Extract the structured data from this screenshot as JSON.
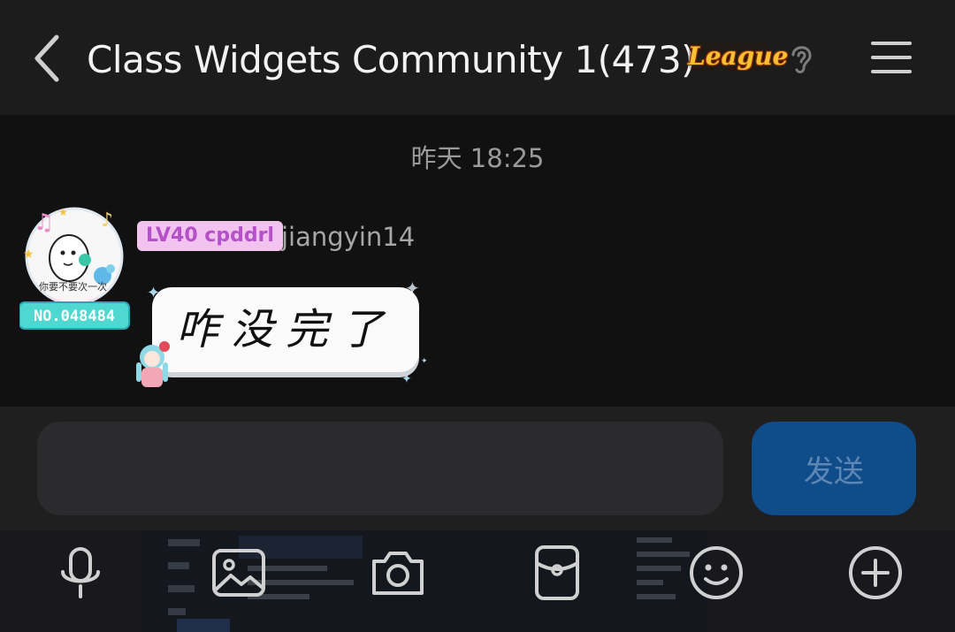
{
  "header": {
    "title": "Class Widgets Community 1(473)",
    "badge": "League",
    "icons": [
      "back-icon",
      "ear-icon",
      "menu-icon"
    ]
  },
  "chat": {
    "timestamp": "昨天 18:25",
    "messages": [
      {
        "level_badge": "LV40 cpddrl",
        "sender": "jiangyin14",
        "text": "咋没完了",
        "avatar": {
          "caption": "你要不要次一次",
          "number": "NO.048484"
        }
      }
    ]
  },
  "input": {
    "value": "",
    "placeholder": "",
    "send_label": "发送"
  },
  "toolbar": {
    "icons": [
      "microphone-icon",
      "image-icon",
      "camera-icon",
      "red-packet-icon",
      "emoji-icon",
      "plus-icon"
    ]
  },
  "colors": {
    "header_bg": "#1c1c1d",
    "chat_bg": "#111111",
    "send_button": "#0f4c8a",
    "level_badge_bg": "#f3c3f0",
    "level_badge_text": "#b451c9"
  }
}
